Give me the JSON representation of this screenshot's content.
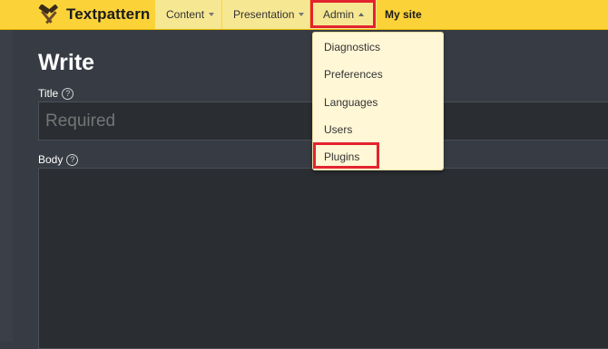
{
  "app": {
    "brand": "Textpattern"
  },
  "nav": {
    "content": "Content",
    "presentation": "Presentation",
    "admin": "Admin",
    "my_site": "My site"
  },
  "admin_menu": {
    "items": [
      "Diagnostics",
      "Preferences",
      "Languages",
      "Users",
      "Plugins"
    ]
  },
  "page": {
    "title": "Write",
    "title_label": "Title",
    "title_placeholder": "Required",
    "body_label": "Body",
    "help_glyph": "?"
  },
  "colors": {
    "topbar": "#fbd339",
    "background": "#373b43",
    "highlight": "#e3232f"
  },
  "icons": {
    "brand": "hammer-icon",
    "help": "help-circle-icon"
  }
}
